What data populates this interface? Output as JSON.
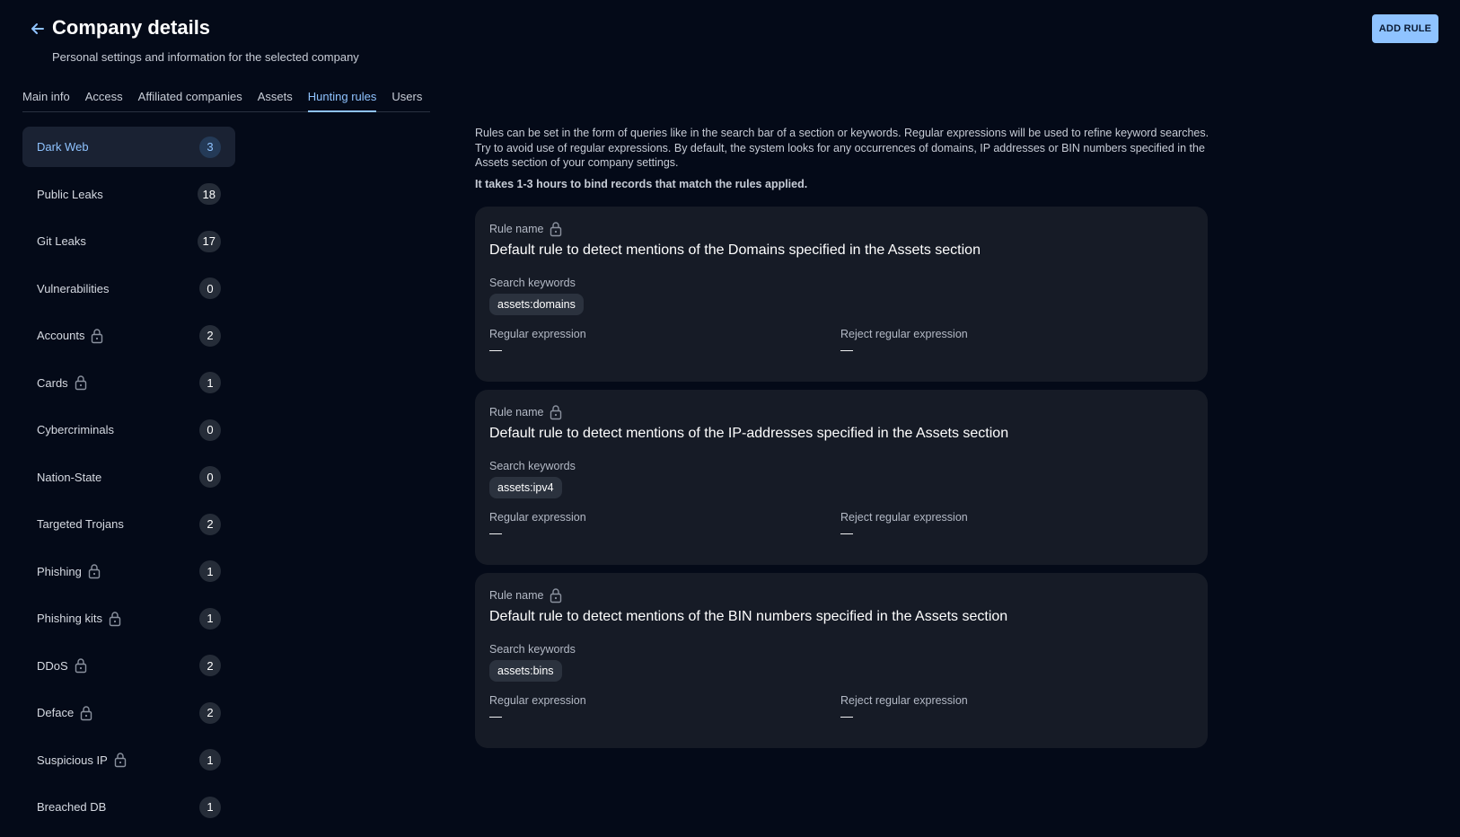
{
  "header": {
    "title": "Company details",
    "subtitle": "Personal settings and information for the selected company",
    "back_icon": "arrow-left-icon",
    "add_rule_label": "ADD RULE"
  },
  "tabs": [
    {
      "label": "Main info",
      "active": false
    },
    {
      "label": "Access",
      "active": false
    },
    {
      "label": "Affiliated companies",
      "active": false
    },
    {
      "label": "Assets",
      "active": false
    },
    {
      "label": "Hunting rules",
      "active": true
    },
    {
      "label": "Users",
      "active": false
    }
  ],
  "sidebar": {
    "items": [
      {
        "label": "Dark Web",
        "count": "3",
        "locked": false,
        "active": true
      },
      {
        "label": "Public Leaks",
        "count": "18",
        "locked": false,
        "active": false
      },
      {
        "label": "Git Leaks",
        "count": "17",
        "locked": false,
        "active": false
      },
      {
        "label": "Vulnerabilities",
        "count": "0",
        "locked": false,
        "active": false
      },
      {
        "label": "Accounts",
        "count": "2",
        "locked": true,
        "active": false
      },
      {
        "label": "Cards",
        "count": "1",
        "locked": true,
        "active": false
      },
      {
        "label": "Cybercriminals",
        "count": "0",
        "locked": false,
        "active": false
      },
      {
        "label": "Nation-State",
        "count": "0",
        "locked": false,
        "active": false
      },
      {
        "label": "Targeted Trojans",
        "count": "2",
        "locked": false,
        "active": false
      },
      {
        "label": "Phishing",
        "count": "1",
        "locked": true,
        "active": false
      },
      {
        "label": "Phishing kits",
        "count": "1",
        "locked": true,
        "active": false
      },
      {
        "label": "DDoS",
        "count": "2",
        "locked": true,
        "active": false
      },
      {
        "label": "Deface",
        "count": "2",
        "locked": true,
        "active": false
      },
      {
        "label": "Suspicious IP",
        "count": "1",
        "locked": true,
        "active": false
      },
      {
        "label": "Breached DB",
        "count": "1",
        "locked": false,
        "active": false
      }
    ]
  },
  "info": {
    "text": "Rules can be set in the form of queries like in the search bar of a section or keywords. Regular expressions will be used to refine keyword searches. Try to avoid use of regular expressions. By default, the system looks for any occurrences of domains, IP addresses or BIN numbers specified in the Assets section of your company settings.",
    "note": "It takes 1-3 hours to bind records that match the rules applied."
  },
  "rules": [
    {
      "name_label": "Rule name",
      "title": "Default rule to detect mentions of the Domains specified in the Assets section",
      "keywords_label": "Search keywords",
      "keyword": "assets:domains",
      "regex_label": "Regular expression",
      "regex_value": "—",
      "reject_label": "Reject regular expression",
      "reject_value": "—"
    },
    {
      "name_label": "Rule name",
      "title": "Default rule to detect mentions of the IP-addresses specified in the Assets section",
      "keywords_label": "Search keywords",
      "keyword": "assets:ipv4",
      "regex_label": "Regular expression",
      "regex_value": "—",
      "reject_label": "Reject regular expression",
      "reject_value": "—"
    },
    {
      "name_label": "Rule name",
      "title": "Default rule to detect mentions of the BIN numbers specified in the Assets section",
      "keywords_label": "Search keywords",
      "keyword": "assets:bins",
      "regex_label": "Regular expression",
      "regex_value": "—",
      "reject_label": "Reject regular expression",
      "reject_value": "—"
    }
  ],
  "colors": {
    "background": "#040a18",
    "accent": "#8fc3ff",
    "card": "#161b26",
    "active_item": "#1a2233"
  },
  "icons": {
    "lock": "lock-icon",
    "back": "arrow-left-icon"
  }
}
